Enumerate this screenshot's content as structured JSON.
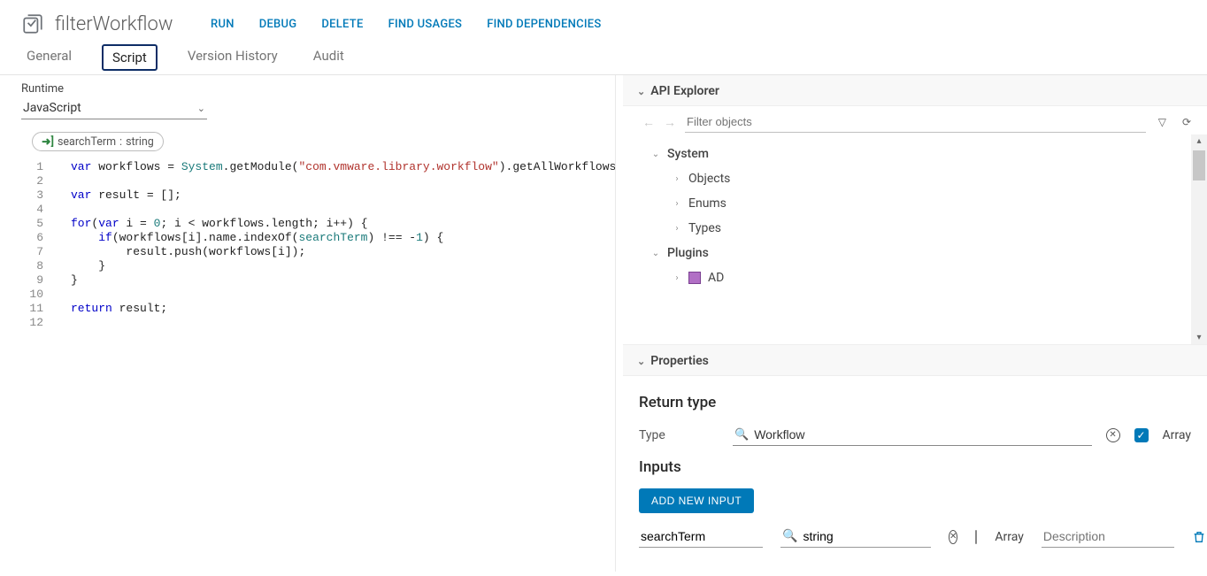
{
  "header": {
    "title": "filterWorkflow",
    "actions": [
      "RUN",
      "DEBUG",
      "DELETE",
      "FIND USAGES",
      "FIND DEPENDENCIES"
    ]
  },
  "tabs": [
    "General",
    "Script",
    "Version History",
    "Audit"
  ],
  "active_tab": "Script",
  "runtime": {
    "label": "Runtime",
    "value": "JavaScript"
  },
  "param_chip": {
    "name": "searchTerm",
    "type": "string"
  },
  "code": {
    "lines": [
      "1",
      "2",
      "3",
      "4",
      "5",
      "6",
      "7",
      "8",
      "9",
      "10",
      "11",
      "12"
    ],
    "l1_kw": "var",
    "l1_a": " workflows = ",
    "l1_obj": "System",
    "l1_b": ".getModule(",
    "l1_str": "\"com.vmware.library.workflow\"",
    "l1_c": ").getAllWorkflows();",
    "l3_kw": "var",
    "l3_a": " result = [];",
    "l5_kw1": "for",
    "l5_a": "(",
    "l5_kw2": "var",
    "l5_b": " i = ",
    "l5_n1": "0",
    "l5_c": "; i < workflows.length; i++) {",
    "l6_a": "    ",
    "l6_kw": "if",
    "l6_b": "(workflows[i].name.indexOf(",
    "l6_id": "searchTerm",
    "l6_c": ") !== -",
    "l6_n": "1",
    "l6_d": ") {",
    "l7": "        result.push(workflows[i]);",
    "l8": "    }",
    "l9": "}",
    "l11_kw": "return",
    "l11_a": " result;"
  },
  "api": {
    "title": "API Explorer",
    "filter_placeholder": "Filter objects",
    "tree": {
      "system": "System",
      "objects": "Objects",
      "enums": "Enums",
      "types": "Types",
      "plugins": "Plugins",
      "ad": "AD"
    }
  },
  "props": {
    "title": "Properties",
    "return_type_section": "Return type",
    "type_label": "Type",
    "type_value": "Workflow",
    "array_label": "Array",
    "inputs_section": "Inputs",
    "add_btn": "ADD NEW INPUT",
    "input_name": "searchTerm",
    "input_type": "string",
    "input_array_label": "Array",
    "desc_placeholder": "Description"
  }
}
